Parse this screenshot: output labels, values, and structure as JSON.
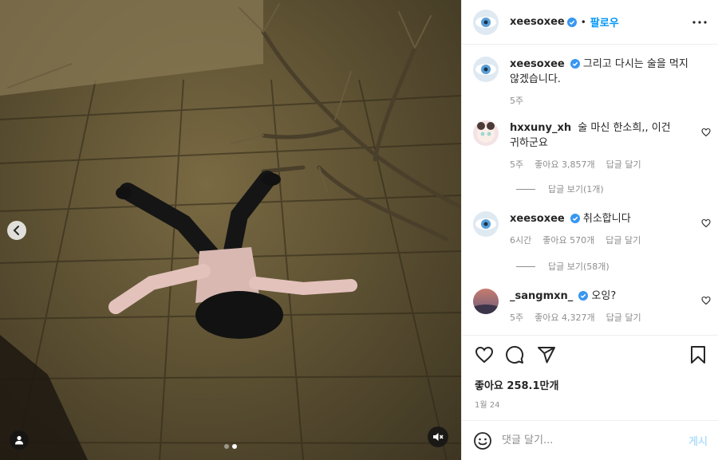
{
  "media": {
    "slide_count": 2,
    "active_slide": 2,
    "prev_icon": "chevron-left-icon",
    "tag_icon": "person-icon",
    "mute_icon": "speaker-muted-icon"
  },
  "header": {
    "username": "xeesoxee",
    "verified": true,
    "separator": "•",
    "follow_label": "팔로우",
    "more_icon": "more-horizontal-icon"
  },
  "caption": {
    "username": "xeesoxee",
    "text": "그리고 다시는 술을 먹지 않겠습니다.",
    "time": "5주"
  },
  "comments": [
    {
      "username": "hxxuny_xh",
      "verified": false,
      "text": "술 마신 한소희,, 이건 귀하군요",
      "time": "5주",
      "likes": "좋아요 3,857개",
      "reply_label": "답글 달기",
      "view_replies": "답글 보기(1개)"
    },
    {
      "username": "xeesoxee",
      "verified": true,
      "text": "취소합니다",
      "time": "6시간",
      "likes": "좋아요 570개",
      "reply_label": "답글 달기",
      "view_replies": "답글 보기(58개)"
    },
    {
      "username": "_sangmxn_",
      "verified": true,
      "text": "오잉?",
      "time": "5주",
      "likes": "좋아요 4,327개",
      "reply_label": "답글 달기",
      "view_replies": ""
    }
  ],
  "actions": {
    "like_icon": "heart-icon",
    "comment_icon": "comment-icon",
    "share_icon": "paper-plane-icon",
    "save_icon": "bookmark-icon",
    "likes_text": "좋아요 258.1만개",
    "date": "1월 24"
  },
  "composer": {
    "emoji_icon": "smiley-icon",
    "placeholder": "댓글 달기...",
    "post_label": "게시"
  },
  "colors": {
    "accent": "#0095f6",
    "verified": "#3897f0",
    "muted_text": "#8e8e8e",
    "disabled_post": "#b2dffc"
  }
}
